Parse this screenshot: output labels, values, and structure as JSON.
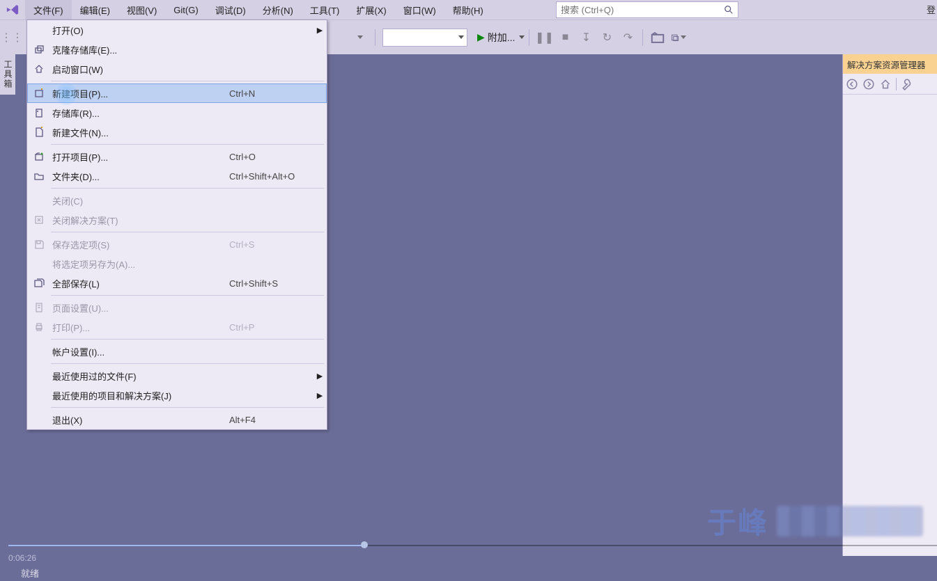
{
  "menu": {
    "items": [
      "文件(F)",
      "编辑(E)",
      "视图(V)",
      "Git(G)",
      "调试(D)",
      "分析(N)",
      "工具(T)",
      "扩展(X)",
      "窗口(W)",
      "帮助(H)"
    ]
  },
  "search": {
    "placeholder": "搜索 (Ctrl+Q)"
  },
  "login_label": "登",
  "toolbar": {
    "attach": "附加...",
    "play_glyph": "▶"
  },
  "left_tab": "工具箱",
  "dropdown": {
    "items": [
      {
        "label": "打开(O)",
        "shortcut": "",
        "submenu": true,
        "icon": "",
        "sep_after": false
      },
      {
        "label": "克隆存储库(E)...",
        "shortcut": "",
        "icon": "clone",
        "sep_after": false
      },
      {
        "label": "启动窗口(W)",
        "shortcut": "",
        "icon": "home",
        "sep_after": true
      },
      {
        "label": "新建项目(P)...",
        "shortcut": "Ctrl+N",
        "icon": "newproj",
        "highlight": true,
        "sep_after": false
      },
      {
        "label": "存储库(R)...",
        "shortcut": "",
        "icon": "repo",
        "sep_after": false
      },
      {
        "label": "新建文件(N)...",
        "shortcut": "",
        "icon": "newfile",
        "sep_after": true
      },
      {
        "label": "打开项目(P)...",
        "shortcut": "Ctrl+O",
        "icon": "openproj",
        "sep_after": false
      },
      {
        "label": "文件夹(D)...",
        "shortcut": "Ctrl+Shift+Alt+O",
        "icon": "folder",
        "sep_after": true
      },
      {
        "label": "关闭(C)",
        "shortcut": "",
        "icon": "",
        "disabled": true,
        "sep_after": false
      },
      {
        "label": "关闭解决方案(T)",
        "shortcut": "",
        "icon": "closesln",
        "disabled": true,
        "sep_after": true
      },
      {
        "label": "保存选定项(S)",
        "shortcut": "Ctrl+S",
        "icon": "save",
        "disabled": true,
        "sep_after": false
      },
      {
        "label": "将选定项另存为(A)...",
        "shortcut": "",
        "icon": "",
        "disabled": true,
        "sep_after": false
      },
      {
        "label": "全部保存(L)",
        "shortcut": "Ctrl+Shift+S",
        "icon": "saveall",
        "sep_after": true
      },
      {
        "label": "页面设置(U)...",
        "shortcut": "",
        "icon": "page",
        "disabled": true,
        "sep_after": false
      },
      {
        "label": "打印(P)...",
        "shortcut": "Ctrl+P",
        "icon": "print",
        "disabled": true,
        "sep_after": true
      },
      {
        "label": "帐户设置(I)...",
        "shortcut": "",
        "icon": "",
        "sep_after": true
      },
      {
        "label": "最近使用过的文件(F)",
        "shortcut": "",
        "icon": "",
        "submenu": true,
        "sep_after": false
      },
      {
        "label": "最近使用的项目和解决方案(J)",
        "shortcut": "",
        "icon": "",
        "submenu": true,
        "sep_after": true
      },
      {
        "label": "退出(X)",
        "shortcut": "Alt+F4",
        "icon": "",
        "sep_after": false
      }
    ]
  },
  "right_panel": {
    "title": "解决方案资源管理器"
  },
  "status": {
    "text": "就绪",
    "timecode": "0:06:26"
  },
  "watermark": "于峰"
}
